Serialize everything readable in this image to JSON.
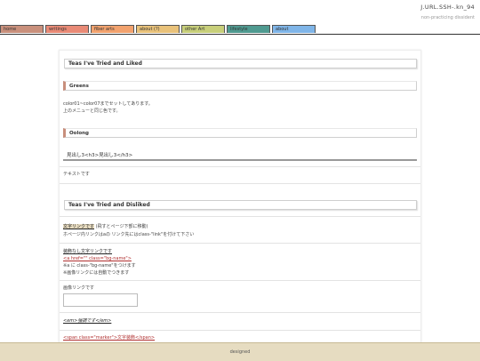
{
  "site": {
    "title": "J.URL.SSH-.kn_94",
    "tagline": "non-practicing dissident"
  },
  "nav": {
    "items": [
      {
        "label": "home",
        "color": "#c9907c"
      },
      {
        "label": "writings",
        "color": "#e98a76"
      },
      {
        "label": "fiber arts",
        "color": "#f2a26e"
      },
      {
        "label": "about (?)",
        "color": "#e9c27a"
      },
      {
        "label": "other Art",
        "color": "#c8cf7a"
      },
      {
        "label": "lifestyle",
        "color": "#4f9a90"
      },
      {
        "label": "about",
        "color": "#7fb5e8"
      }
    ]
  },
  "main": {
    "section1_title": "Teas I've Tried and Liked",
    "greens_title": "Greens",
    "greens_text1": "color01~color07までセットしてあります。",
    "greens_text2": "上のメニューと同じ色です。",
    "oolong_title": "Oolong",
    "h3_sample": "見出し3<h3>見出し3</h3>",
    "text_sample": "テキストです",
    "section2_title": "Teas I've Tried and Disliked",
    "link_text_hl": "文字リンクです",
    "link_text_rest": "(飛すとページ下部に移動)",
    "link_note": "ホページ内リンクはaの リンク先にはclass-\"link\"を付けて下さい",
    "deco_link_title": "装飾なし文字リンクです",
    "deco_link_code": "<a href=\"\" class=\"bg-name\">",
    "deco_link_note1": "※a に class-\"bg-name\"をつけます",
    "deco_link_note2": "※画像リンクには自動でつきます",
    "image_link_label": "画像リンクです",
    "em_sample": "<em>強調です</em>",
    "marker_sample": "<span class=\"marker\">文字装飾</span>"
  },
  "footer": {
    "text": "designed"
  }
}
